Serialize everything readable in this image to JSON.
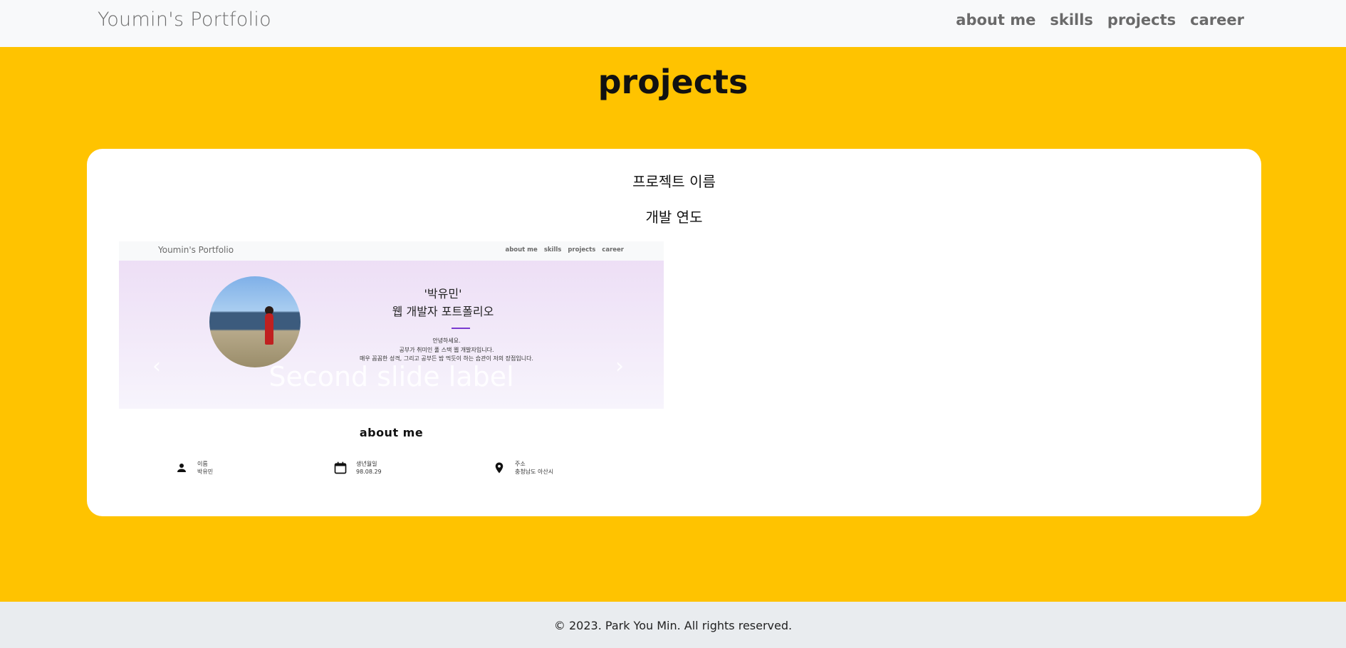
{
  "navbar": {
    "brand": "Youmin's Portfolio",
    "links": [
      "about me",
      "skills",
      "projects",
      "career"
    ]
  },
  "section": {
    "title": "projects"
  },
  "project": {
    "name": "프로젝트 이름",
    "year": "개발 연도"
  },
  "preview": {
    "brand": "Youmin's Portfolio",
    "links": [
      "about me",
      "skills",
      "projects",
      "career"
    ],
    "hero_title_1": "'박유민'",
    "hero_title_2": "웹 개발자 포트폴리오",
    "hero_desc": [
      "안녕하세요.",
      "공부가 취미인 풀 스택 웹 개발자입니다.",
      "매우 꼼꼼한 성격, 그리고 공부든 밤 먹듯이 하는 습관이 저의 장점입니다."
    ],
    "caption": "Second slide label",
    "caption_sub": "",
    "about_title": "about me",
    "info": [
      {
        "icon": "person-icon",
        "label": "이름",
        "value": "박유민"
      },
      {
        "icon": "calendar-icon",
        "label": "생년월일",
        "value": "98.08.29"
      },
      {
        "icon": "location-icon",
        "label": "주소",
        "value": "충청남도 아산시"
      }
    ]
  },
  "footer": {
    "text": "© 2023. Park You Min. All rights reserved."
  },
  "colors": {
    "background": "#ffc300",
    "card": "#ffffff",
    "navbar": "#f8f9fa",
    "footer": "#e9ecef",
    "accent": "#7a3ad0"
  }
}
